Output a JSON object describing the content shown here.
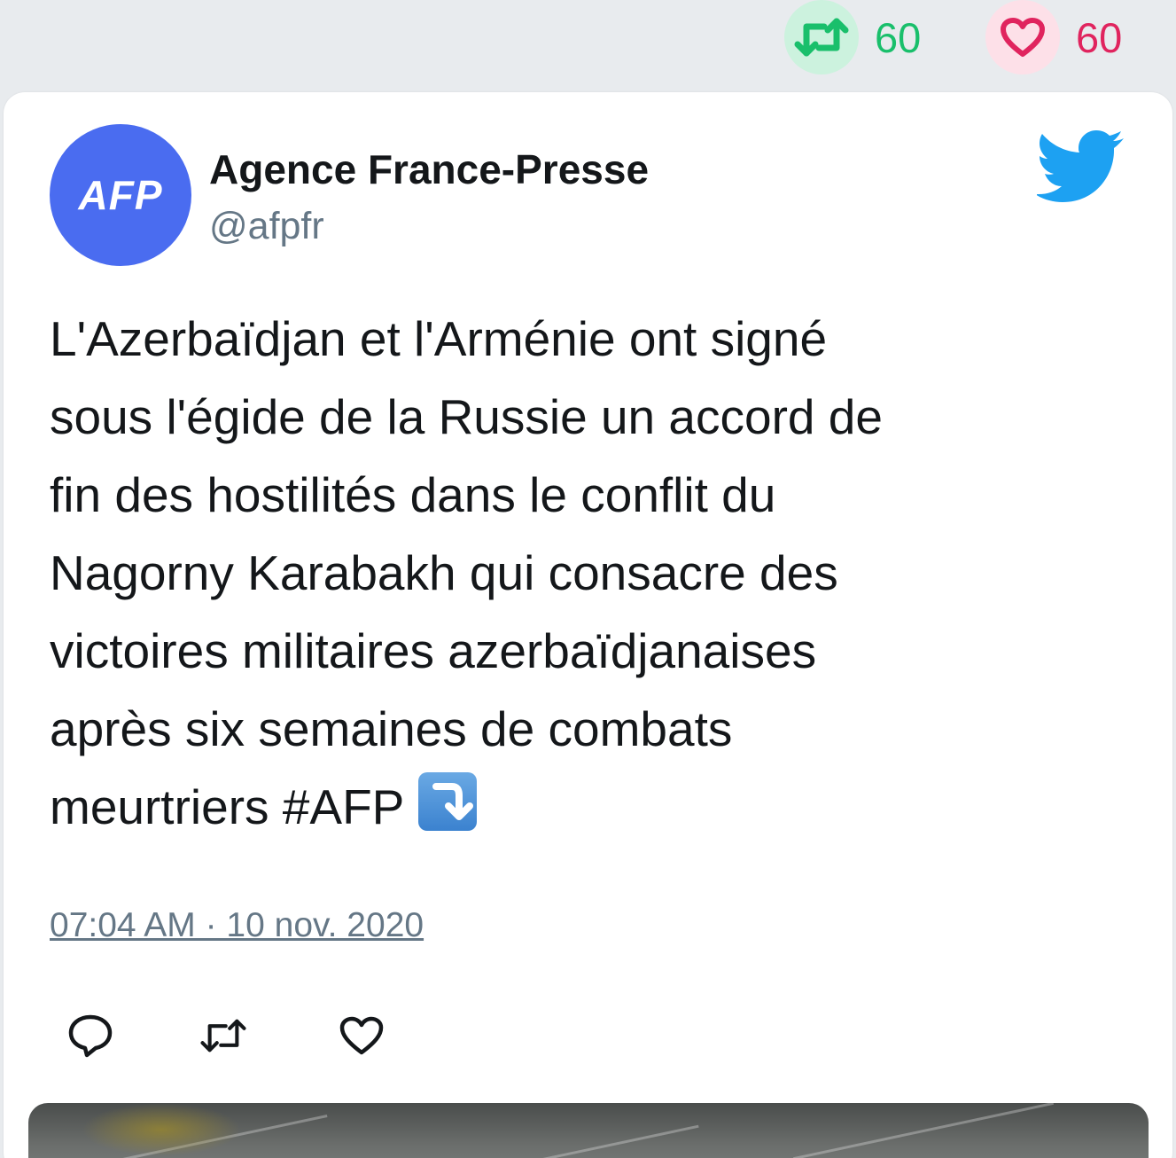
{
  "stats": {
    "retweet_count": "60",
    "like_count": "60",
    "retweet_icon": "retweet-icon",
    "like_icon": "heart-icon"
  },
  "tweet": {
    "avatar_text": "AFP",
    "author_name": "Agence France-Presse",
    "author_handle": "@afpfr",
    "text": "L'Azerbaïdjan et l'Arménie ont signé\nsous l'égide de la Russie un accord de\nfin des hostilités dans le conflit du\nNagorny Karabakh qui consacre des\nvictoires militaires azerbaïdjanaises\naprès six semaines de combats\nmeurtriers #AFP",
    "emoji": "arrow-down-right-emoji",
    "timestamp": "07:04 AM · 10 nov. 2020",
    "actions": [
      "reply-icon",
      "retweet-icon",
      "heart-icon"
    ],
    "logo": "twitter-bird-icon"
  },
  "colors": {
    "retweet_green": "#19bf6b",
    "like_red": "#e0245e",
    "twitter_blue": "#1da1f2",
    "avatar_blue": "#4a6cf0",
    "muted_gray": "#657786"
  }
}
